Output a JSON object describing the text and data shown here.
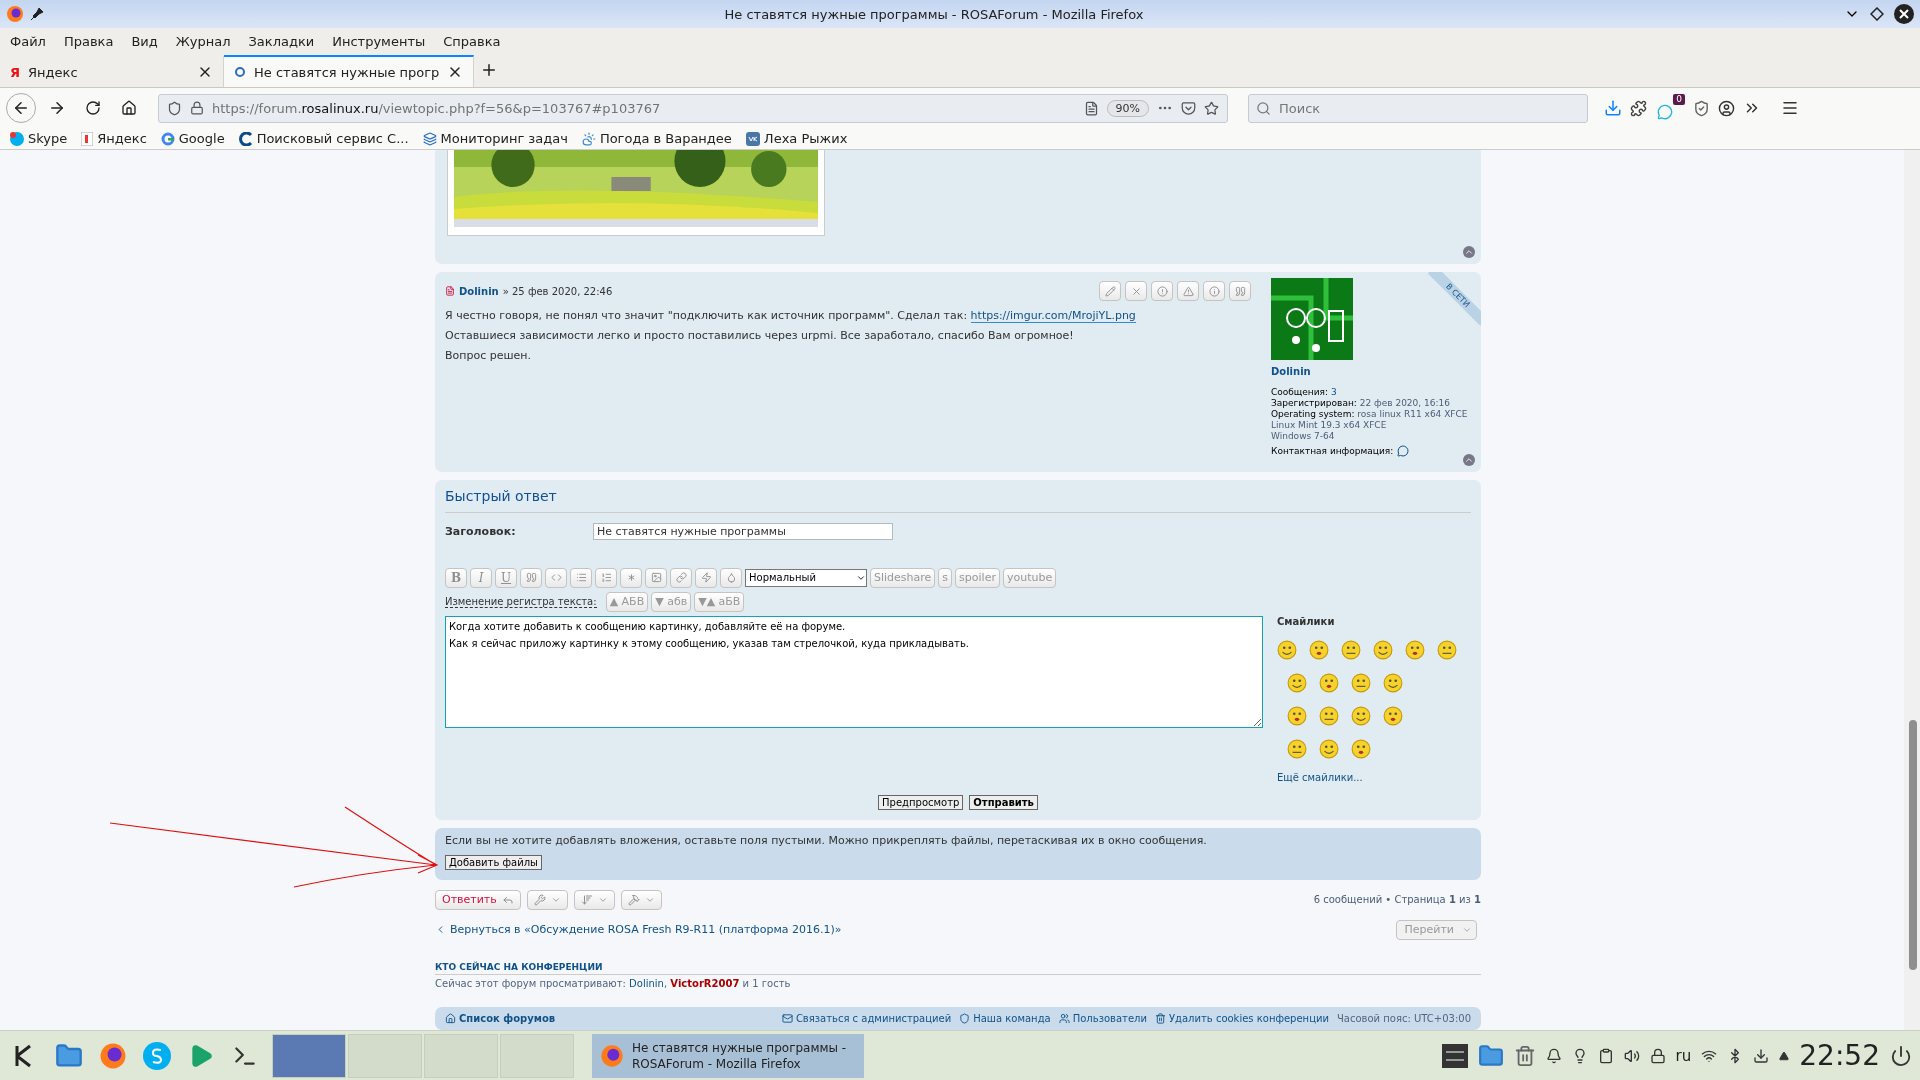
{
  "window": {
    "title": "Не ставятся нужные программы - ROSAForum - Mozilla Firefox"
  },
  "menu": [
    "Файл",
    "Правка",
    "Вид",
    "Журнал",
    "Закладки",
    "Инструменты",
    "Справка"
  ],
  "tabs": [
    {
      "favicon": "Я",
      "label": "Яндекс",
      "selected": false
    },
    {
      "label": "Не ставятся нужные прогр",
      "selected": true
    }
  ],
  "address": {
    "prefix": "https://forum.",
    "domain": "rosalinux.ru",
    "path": "/viewtopic.php?f=56&p=103767#p103767",
    "zoom": "90%"
  },
  "search": {
    "placeholder": "Поиск"
  },
  "addon_badge": "0",
  "bookmarks": [
    {
      "label": "Skype"
    },
    {
      "label": "Яндекс"
    },
    {
      "label": "Google"
    },
    {
      "label": "Поисковый сервис С..."
    },
    {
      "label": "Мониторинг задач"
    },
    {
      "label": "Погода в Варандее"
    },
    {
      "label": "Леха Рыжих"
    }
  ],
  "post": {
    "author": "Dolinin",
    "date": "» 25 фев 2020, 22:46",
    "paragraphs": [
      {
        "text": "Я честно говоря, не понял что значит \"подключить как источник программ\". Сделал так:",
        "link": "https://imgur.com/MrojiYL.png"
      },
      {
        "text": "Оставшиеся зависимости легко и просто поставились через urpmi. Все заработало, спасибо Вам огромное!"
      },
      {
        "text": "Вопрос решен."
      }
    ],
    "profile": {
      "ribbon": "В СЕТИ",
      "name": "Dolinin",
      "fields": [
        {
          "label": "Сообщения:",
          "value": "3"
        },
        {
          "label": "Зарегистрирован:",
          "value": "22 фев 2020, 16:16"
        },
        {
          "label": "Operating system:",
          "value": "rosa linux R11 x64 XFCE"
        }
      ],
      "extra_lines": [
        "Linux Mint 19.3 x64 XFCE",
        "Windows 7-64"
      ],
      "contact_label": "Контактная информация:"
    }
  },
  "quick_reply": {
    "title": "Быстрый ответ",
    "subject_label": "Заголовок:",
    "subject_value": "Не ставятся нужные программы",
    "format_buttons": [
      "B",
      "I",
      "U"
    ],
    "size_select": "Нормальный",
    "text_buttons": [
      "Slideshare",
      "s",
      "spoiler",
      "youtube"
    ],
    "case_label": "Изменение регистра текста:",
    "case_buttons": [
      "▲ АБВ",
      "▼ абв",
      "▼▲ аБВ"
    ],
    "message_lines": [
      "Когда хотите добавить к сообщению картинку, добавляйте её на форуме.",
      "Как я сейчас приложу картинку к этому сообщению, указав там стрелочкой, куда прикладывать."
    ],
    "smilies_title": "Смайлики",
    "more_smilies": "Ещё смайлики...",
    "preview_button": "Предпросмотр",
    "submit_button": "Отправить"
  },
  "attachments": {
    "note": "Если вы не хотите добавлять вложения, оставьте поля пустыми. Можно прикреплять файлы, перетаскивая их в окно сообщения.",
    "button": "Добавить файлы"
  },
  "actions": {
    "reply": "Ответить",
    "pagination": "6 сообщений • Страница **1** из **1**"
  },
  "back_link": "Вернуться в «Обсуждение ROSA Fresh R9-R11 (платформа 2016.1)»",
  "jump_button": "Перейти",
  "online": {
    "title": "КТО СЕЙЧАС НА КОНФЕРЕНЦИИ",
    "prefix": "Сейчас этот форум просматривают:",
    "users": [
      {
        "name": "Dolinin",
        "after": ",",
        "color": "#105289"
      },
      {
        "name": "VictorR2007",
        "color": "#aa0000"
      }
    ],
    "suffix": "и 1 гость"
  },
  "footer": {
    "home": "Список форумов",
    "links": [
      "Связаться с администрацией",
      "Наша команда",
      "Пользователи",
      "Удалить cookies конференции"
    ],
    "timezone": "Часовой пояс: UTC+03:00"
  },
  "taskbar": {
    "desktops": [
      {
        "selected": true
      },
      {
        "selected": false
      },
      {
        "selected": false
      },
      {
        "selected": false
      }
    ],
    "task_lines": [
      "Не ставятся нужные программы -",
      "ROSAForum - Mozilla Firefox"
    ],
    "language": "ru",
    "clock": "22:52"
  }
}
